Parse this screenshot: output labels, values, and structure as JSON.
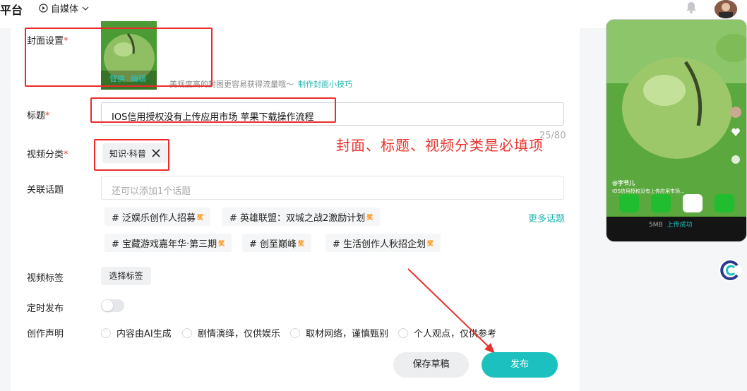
{
  "header": {
    "brand": "平台",
    "media_switch": "自媒体"
  },
  "form": {
    "cover": {
      "label": "封面设置",
      "required": "*",
      "replace": "替换",
      "edit": "编辑",
      "hint": "美观度高的封图更容易获得流量哦～",
      "tips_link": "制作封面小技巧"
    },
    "title": {
      "label": "标题",
      "required": "*",
      "value": "IOS信用授权没有上传应用市场 苹果下载操作流程",
      "counter": "25/80"
    },
    "category": {
      "label": "视频分类",
      "required": "*",
      "value": "知识·科普"
    },
    "annotation": "封面、标题、视频分类是必填项",
    "topics": {
      "label": "关联话题",
      "placeholder": "还可以添加1个话题",
      "more": "更多话题",
      "hot_badge": "奖",
      "items": [
        "# 泛娱乐创作人招募",
        "# 英雄联盟：双城之战2激励计划",
        "# 宝藏游戏嘉年华·第三期",
        "# 创至巅峰",
        "# 生活创作人秋招企划"
      ]
    },
    "video_tags": {
      "label": "视频标签",
      "button": "选择标签"
    },
    "schedule": {
      "label": "定时发布",
      "enabled": false
    },
    "declaration": {
      "label": "创作声明",
      "options": [
        "内容由AI生成",
        "剧情演绎，仅供娱乐",
        "取材网络，谨慎甄别",
        "个人观点，仅供参考"
      ]
    },
    "actions": {
      "save": "保存草稿",
      "publish": "发布"
    }
  },
  "preview": {
    "author": "@字节儿",
    "caption": "IOS信用授权没有上传应用市场...",
    "status_size": "5MB",
    "status_text": "上传成功"
  },
  "colors": {
    "accent": "#1cc1bf",
    "required": "#f04040",
    "annotation": "#e8332d",
    "hot": "#ff8a00"
  }
}
